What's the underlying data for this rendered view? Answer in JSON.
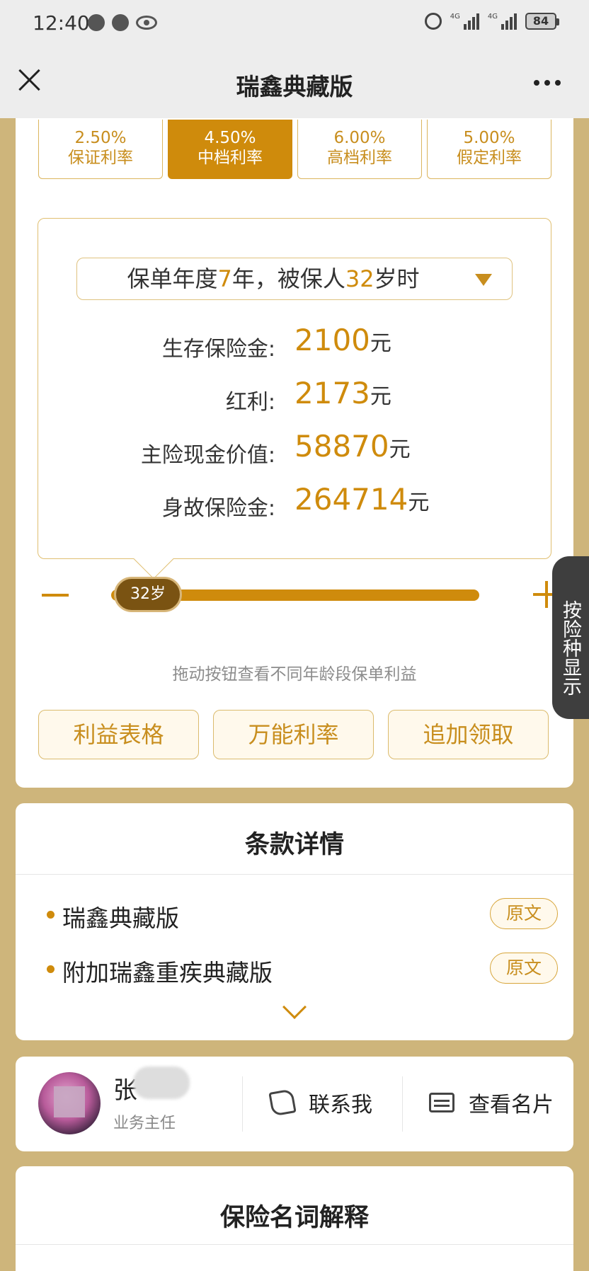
{
  "status_bar": {
    "time": "12:40",
    "battery": "84",
    "network": "4G"
  },
  "nav": {
    "title": "瑞鑫典藏版"
  },
  "rate_tabs": [
    {
      "rate": "2.50%",
      "label": "保证利率",
      "active": false
    },
    {
      "rate": "4.50%",
      "label": "中档利率",
      "active": true
    },
    {
      "rate": "6.00%",
      "label": "高档利率",
      "active": false
    },
    {
      "rate": "5.00%",
      "label": "假定利率",
      "active": false
    }
  ],
  "year_select": {
    "prefix": "保单年度",
    "year": "7",
    "mid": "年，被保人",
    "age": "32",
    "suffix": "岁时"
  },
  "benefits": [
    {
      "label": "生存保险金:",
      "value": "2100",
      "unit": "元"
    },
    {
      "label": "红利:",
      "value": "2173",
      "unit": "元"
    },
    {
      "label": "主险现金价值:",
      "value": "58870",
      "unit": "元"
    },
    {
      "label": "身故保险金:",
      "value": "264714",
      "unit": "元"
    }
  ],
  "slider": {
    "knob_label": "32岁",
    "hint": "拖动按钮查看不同年龄段保单利益"
  },
  "actions": [
    "利益表格",
    "万能利率",
    "追加领取"
  ],
  "side_tab": "按险种显示",
  "terms": {
    "title": "条款详情",
    "items": [
      {
        "name": "瑞鑫典藏版",
        "button": "原文"
      },
      {
        "name": "附加瑞鑫重疾典藏版",
        "button": "原文"
      }
    ]
  },
  "agent": {
    "name": "张",
    "title": "业务主任",
    "contact_label": "联系我",
    "namecard_label": "查看名片"
  },
  "glossary": {
    "title": "保险名词解释"
  },
  "colors": {
    "accent": "#cf8b0c",
    "background": "#ceb57b"
  }
}
